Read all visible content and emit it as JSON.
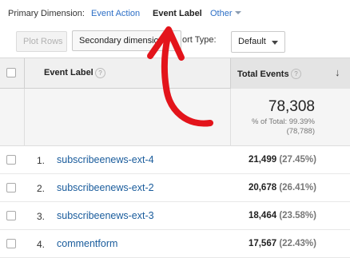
{
  "dimension_bar": {
    "label": "Primary Dimension:",
    "options": [
      {
        "label": "Event Action",
        "active": false
      },
      {
        "label": "Event Label",
        "active": true
      },
      {
        "label": "Other",
        "active": false
      }
    ]
  },
  "toolbar": {
    "plot_rows_label": "Plot Rows",
    "secondary_dimension_label": "Secondary dimension",
    "sort_type_label": "ort Type:",
    "sort_select_value": "Default"
  },
  "table": {
    "dimension_header": "Event Label",
    "metric_header": "Total Events",
    "help_glyph": "?",
    "sort_glyph": "↓",
    "totals": {
      "value": "78,308",
      "percent_text": "% of Total: 99.39%",
      "absolute_text": "(78,788)"
    },
    "rows": [
      {
        "num": "1.",
        "label": "subscribeenews-ext-4",
        "value": "21,499",
        "pct": "(27.45%)"
      },
      {
        "num": "2.",
        "label": "subscribeenews-ext-2",
        "value": "20,678",
        "pct": "(26.41%)"
      },
      {
        "num": "3.",
        "label": "subscribeenews-ext-3",
        "value": "18,464",
        "pct": "(23.58%)"
      },
      {
        "num": "4.",
        "label": "commentform",
        "value": "17,567",
        "pct": "(22.43%)"
      }
    ]
  },
  "colors": {
    "link": "#2d6fc6",
    "annotation_arrow": "#e3141b"
  },
  "icons": [
    "caret-down-icon",
    "help-icon",
    "sort-down-arrow-icon",
    "checkbox-icon",
    "red-arrow-annotation"
  ]
}
